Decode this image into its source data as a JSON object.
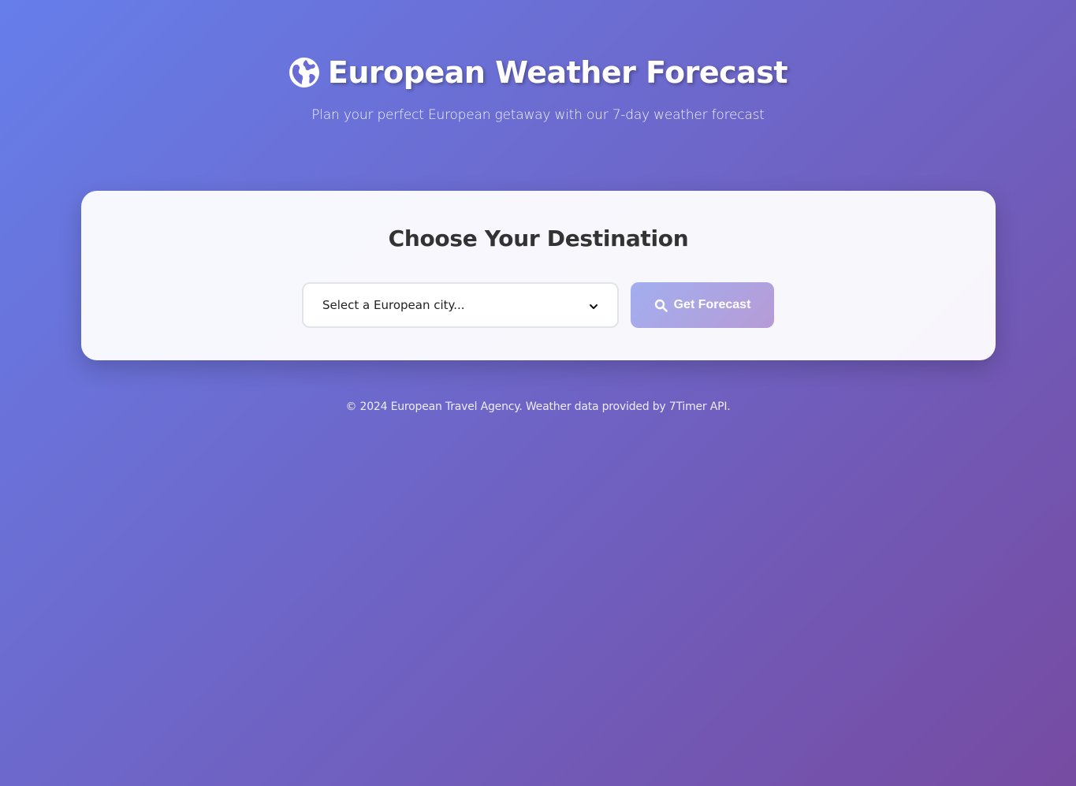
{
  "header": {
    "title": "European Weather Forecast",
    "subtitle": "Plan your perfect European getaway with our 7-day weather forecast",
    "icon": "globe-europe-icon"
  },
  "card": {
    "title": "Choose Your Destination",
    "city_select": {
      "selected": "Select a European city..."
    },
    "forecast_button": {
      "label": "Get Forecast",
      "icon": "search-icon"
    }
  },
  "footer": {
    "text": "© 2024 European Travel Agency. Weather data provided by 7Timer API."
  },
  "colors": {
    "gradient_start": "#667eea",
    "gradient_end": "#764ba2",
    "card_background": "#f7f7fb",
    "heading_text": "#333333",
    "button_gradient_start": "#a3aef0",
    "button_gradient_end": "#b69bd6"
  }
}
